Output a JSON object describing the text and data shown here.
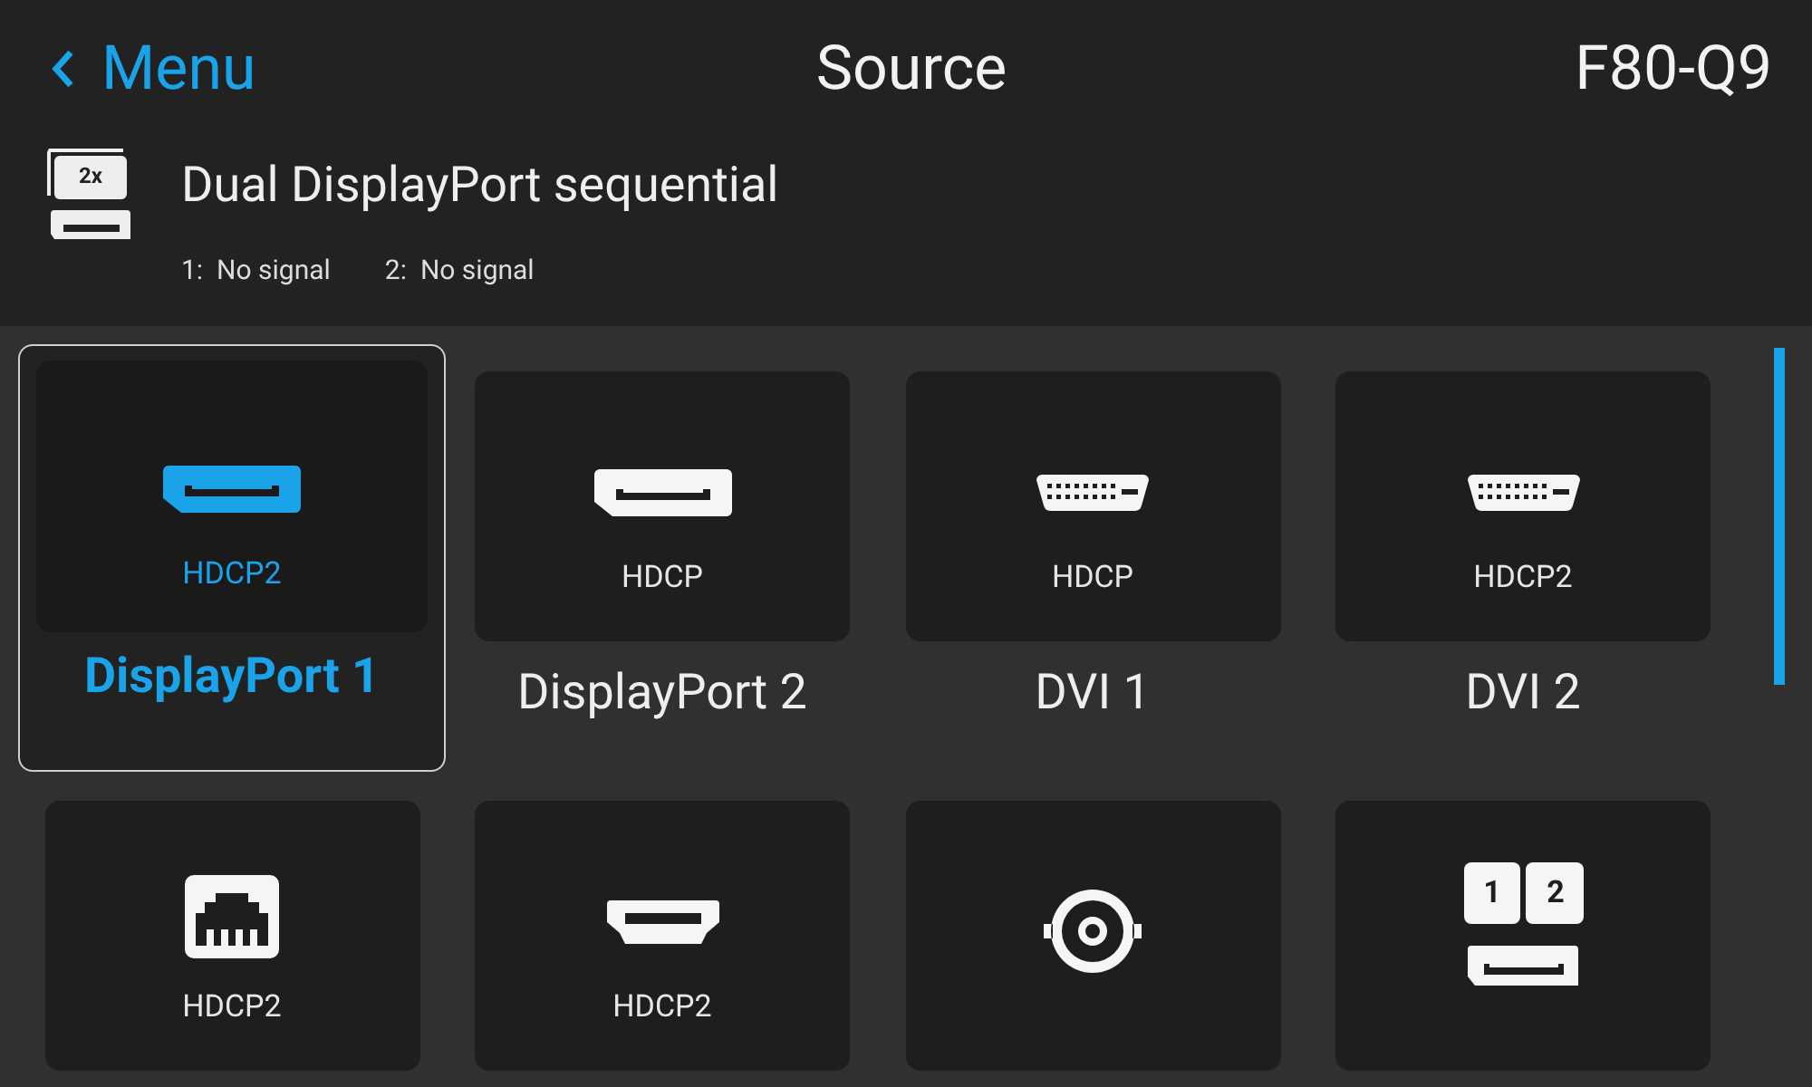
{
  "header": {
    "back_label": "Menu",
    "title": "Source",
    "device": "F80-Q9"
  },
  "current_source": {
    "badge": "2x",
    "name": "Dual DisplayPort sequential",
    "signals": [
      {
        "index": "1:",
        "status": "No signal"
      },
      {
        "index": "2:",
        "status": "No signal"
      }
    ]
  },
  "sources": [
    {
      "kind": "displayport",
      "hdcp": "HDCP2",
      "label": "DisplayPort 1",
      "selected": true
    },
    {
      "kind": "displayport",
      "hdcp": "HDCP",
      "label": "DisplayPort 2",
      "selected": false
    },
    {
      "kind": "dvi",
      "hdcp": "HDCP",
      "label": "DVI 1",
      "selected": false
    },
    {
      "kind": "dvi",
      "hdcp": "HDCP2",
      "label": "DVI 2",
      "selected": false
    },
    {
      "kind": "network",
      "hdcp": "HDCP2",
      "selected": false
    },
    {
      "kind": "hdmi",
      "hdcp": "HDCP2",
      "selected": false
    },
    {
      "kind": "bnc",
      "selected": false
    },
    {
      "kind": "dual",
      "numbers": [
        "1",
        "2"
      ],
      "selected": false
    }
  ]
}
